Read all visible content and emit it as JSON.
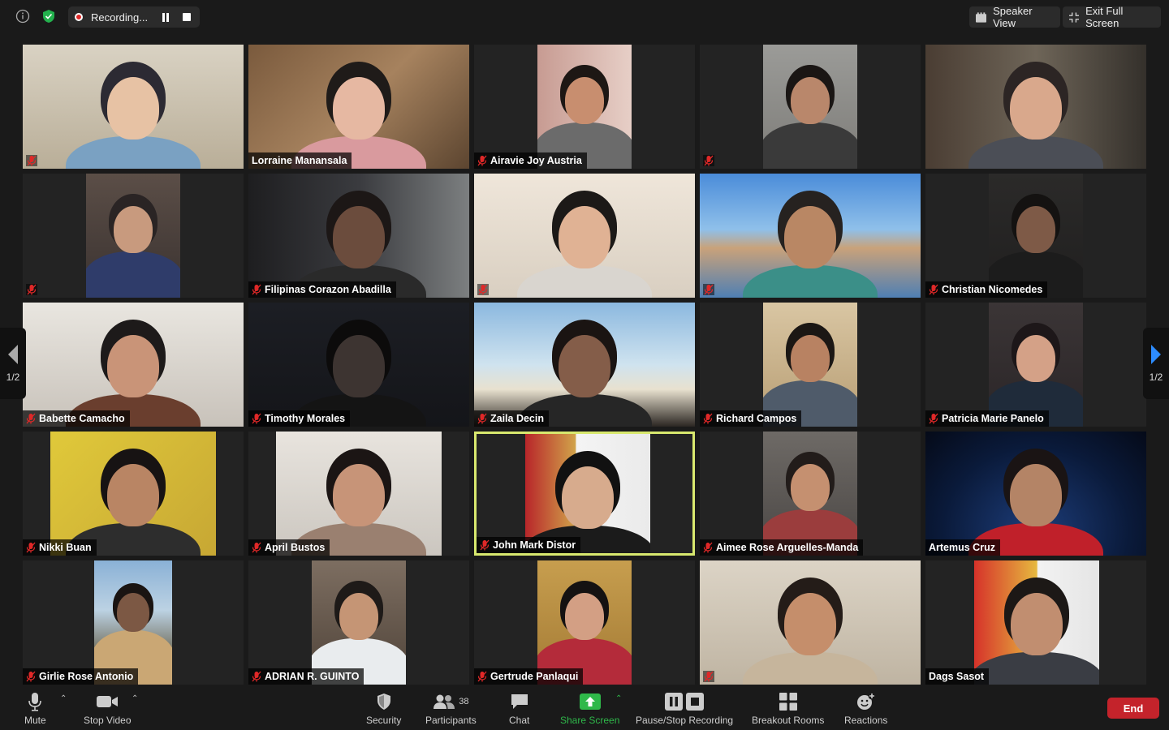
{
  "topbar": {
    "recording_label": "Recording...",
    "speaker_view_label": "Speaker View",
    "exit_fullscreen_label": "Exit Full Screen"
  },
  "pager": {
    "left": "1/2",
    "right": "1/2"
  },
  "participants": [
    {
      "name": "",
      "muted": true
    },
    {
      "name": "Lorraine Manansala",
      "muted": false
    },
    {
      "name": "Airavie Joy Austria",
      "muted": true
    },
    {
      "name": "",
      "muted": true
    },
    {
      "name": "",
      "muted": false
    },
    {
      "name": "",
      "muted": true
    },
    {
      "name": "Filipinas Corazon Abadilla",
      "muted": true
    },
    {
      "name": "",
      "muted": true
    },
    {
      "name": "",
      "muted": true
    },
    {
      "name": "Christian Nicomedes",
      "muted": true
    },
    {
      "name": "Babette Camacho",
      "muted": true
    },
    {
      "name": "Timothy Morales",
      "muted": true
    },
    {
      "name": "Zaila Decin",
      "muted": true
    },
    {
      "name": "Richard Campos",
      "muted": true
    },
    {
      "name": "Patricia Marie Panelo",
      "muted": true
    },
    {
      "name": "Nikki Buan",
      "muted": true
    },
    {
      "name": "April Bustos",
      "muted": true
    },
    {
      "name": "John Mark Distor",
      "muted": true
    },
    {
      "name": "Aimee Rose Arguelles-Manda",
      "muted": true
    },
    {
      "name": "Artemus Cruz",
      "muted": false
    },
    {
      "name": "Girlie Rose Antonio",
      "muted": true
    },
    {
      "name": "ADRIAN R. GUINTO",
      "muted": true
    },
    {
      "name": "Gertrude Panlaqui",
      "muted": true
    },
    {
      "name": "",
      "muted": true
    },
    {
      "name": "Dags Sasot",
      "muted": false
    }
  ],
  "toolbar": {
    "mute": "Mute",
    "stop_video": "Stop Video",
    "security": "Security",
    "participants": "Participants",
    "participants_count": "38",
    "chat": "Chat",
    "share_screen": "Share Screen",
    "pause_stop_recording": "Pause/Stop Recording",
    "breakout_rooms": "Breakout Rooms",
    "reactions": "Reactions",
    "end": "End"
  },
  "colors": {
    "end_button": "#c4232b",
    "share_screen": "#2fb84a",
    "active_speaker_border": "#d8e86e",
    "mute_red": "#e02828"
  }
}
